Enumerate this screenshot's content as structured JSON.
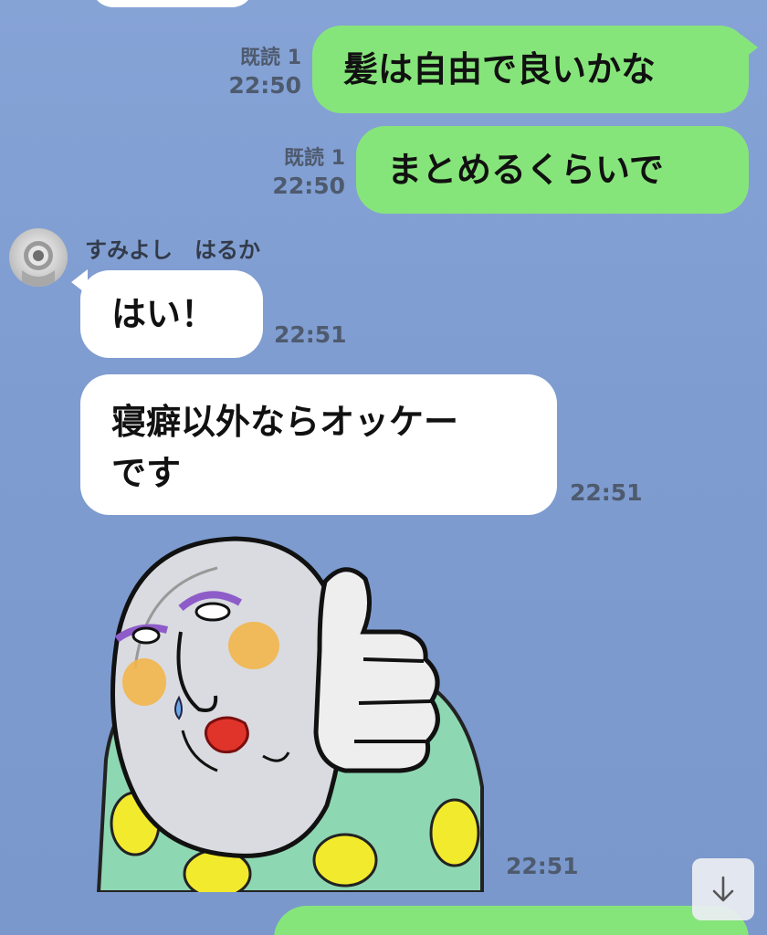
{
  "messages": {
    "m1": {
      "text": "髪は自由で良いかな",
      "read": "既読 1",
      "time": "22:50"
    },
    "m2": {
      "text": "まとめるくらいで",
      "read": "既読 1",
      "time": "22:50"
    },
    "sender": {
      "name": "すみよし　はるか"
    },
    "m3": {
      "text": "はい！",
      "time": "22:51"
    },
    "m4": {
      "line1": "寝癖以外ならオッケー",
      "line2": "です",
      "time": "22:51"
    },
    "sticker": {
      "time": "22:51",
      "description_icon": "thumbs-up-sticker"
    }
  },
  "controls": {
    "scroll_down_icon": "arrow-down-icon"
  },
  "colors": {
    "background": "#7f9dd1",
    "outgoing_bubble": "#86e57a",
    "incoming_bubble": "#ffffff"
  }
}
